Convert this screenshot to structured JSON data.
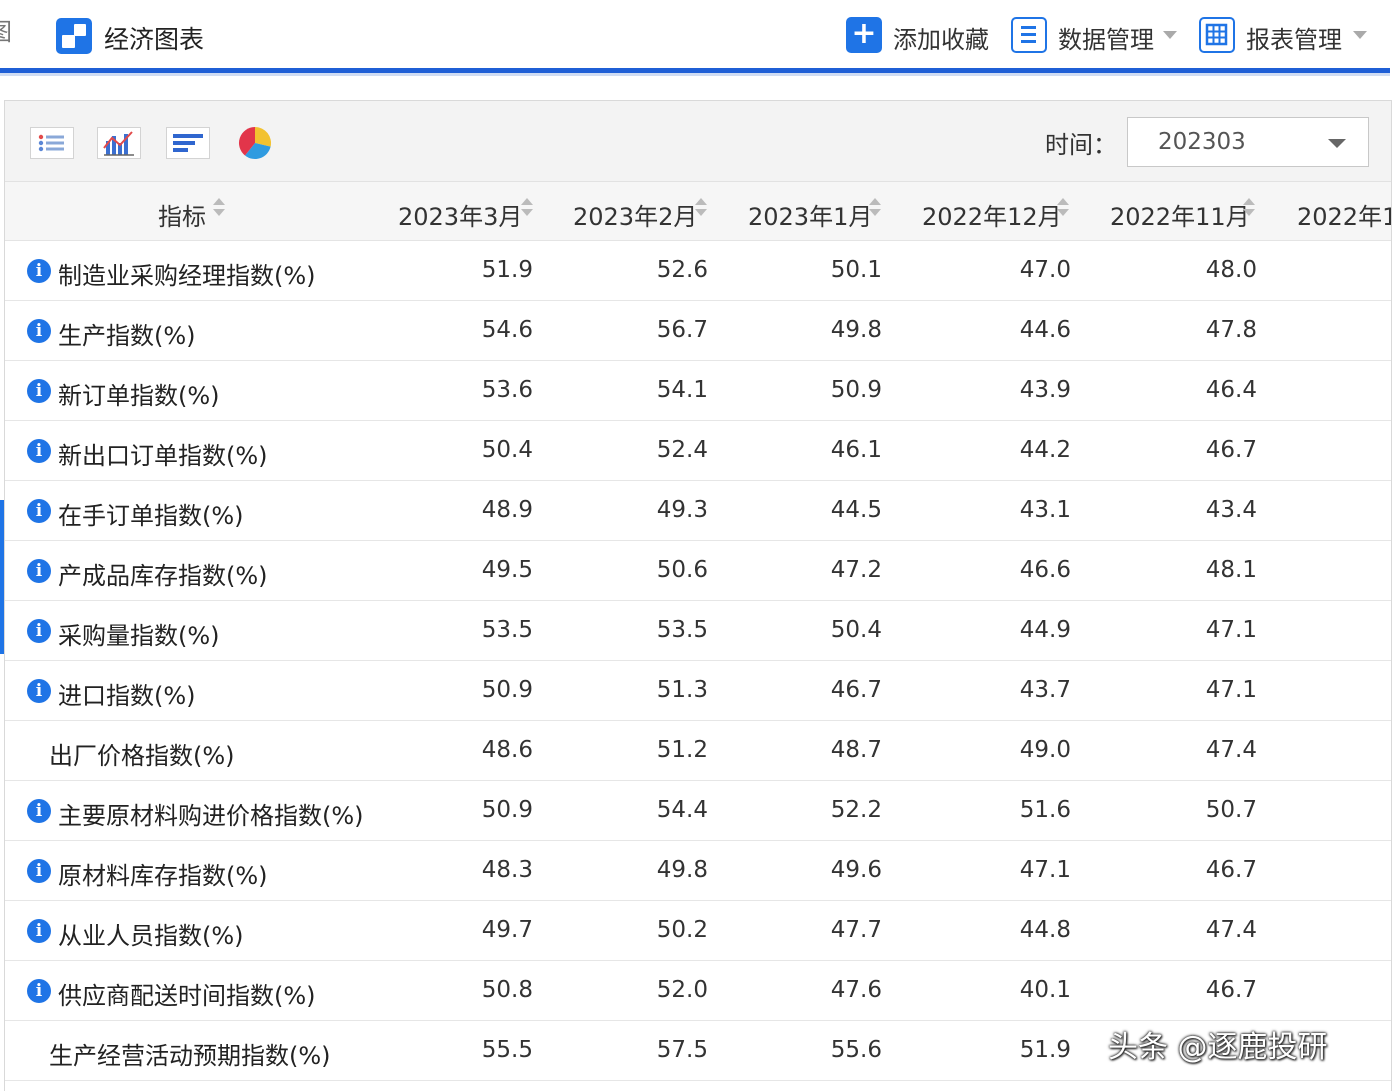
{
  "topbar": {
    "edge_glyph": "图",
    "app_title": "经济图表",
    "buttons": [
      {
        "label": "添加收藏",
        "icon": "plus-icon"
      },
      {
        "label": "数据管理",
        "icon": "list-box-icon"
      },
      {
        "label": "报表管理",
        "icon": "grid-table-icon"
      }
    ],
    "accent_color": "#1f74e6"
  },
  "toolbar": {
    "views": [
      "list-view-icon",
      "bar-chart-view-icon",
      "horizontal-bar-view-icon",
      "pie-chart-view-icon"
    ],
    "time_label": "时间：",
    "time_value": "202303"
  },
  "table": {
    "headers": [
      "指标",
      "2023年3月",
      "2023年2月",
      "2023年1月",
      "2022年12月",
      "2022年11月",
      "2022年1"
    ],
    "rows": [
      {
        "has_info": true,
        "name": "制造业采购经理指数(%)",
        "values": [
          "51.9",
          "52.6",
          "50.1",
          "47.0",
          "48.0"
        ]
      },
      {
        "has_info": true,
        "name": "生产指数(%)",
        "values": [
          "54.6",
          "56.7",
          "49.8",
          "44.6",
          "47.8"
        ]
      },
      {
        "has_info": true,
        "name": "新订单指数(%)",
        "values": [
          "53.6",
          "54.1",
          "50.9",
          "43.9",
          "46.4"
        ]
      },
      {
        "has_info": true,
        "name": "新出口订单指数(%)",
        "values": [
          "50.4",
          "52.4",
          "46.1",
          "44.2",
          "46.7"
        ]
      },
      {
        "has_info": true,
        "name": "在手订单指数(%)",
        "values": [
          "48.9",
          "49.3",
          "44.5",
          "43.1",
          "43.4"
        ]
      },
      {
        "has_info": true,
        "name": "产成品库存指数(%)",
        "values": [
          "49.5",
          "50.6",
          "47.2",
          "46.6",
          "48.1"
        ]
      },
      {
        "has_info": true,
        "name": "采购量指数(%)",
        "values": [
          "53.5",
          "53.5",
          "50.4",
          "44.9",
          "47.1"
        ]
      },
      {
        "has_info": true,
        "name": "进口指数(%)",
        "values": [
          "50.9",
          "51.3",
          "46.7",
          "43.7",
          "47.1"
        ]
      },
      {
        "has_info": false,
        "name": "出厂价格指数(%)",
        "values": [
          "48.6",
          "51.2",
          "48.7",
          "49.0",
          "47.4"
        ]
      },
      {
        "has_info": true,
        "name": "主要原材料购进价格指数(%)",
        "values": [
          "50.9",
          "54.4",
          "52.2",
          "51.6",
          "50.7"
        ]
      },
      {
        "has_info": true,
        "name": "原材料库存指数(%)",
        "values": [
          "48.3",
          "49.8",
          "49.6",
          "47.1",
          "46.7"
        ]
      },
      {
        "has_info": true,
        "name": "从业人员指数(%)",
        "values": [
          "49.7",
          "50.2",
          "47.7",
          "44.8",
          "47.4"
        ]
      },
      {
        "has_info": true,
        "name": "供应商配送时间指数(%)",
        "values": [
          "50.8",
          "52.0",
          "47.6",
          "40.1",
          "46.7"
        ]
      },
      {
        "has_info": false,
        "name": "生产经营活动预期指数(%)",
        "values": [
          "55.5",
          "57.5",
          "55.6",
          "51.9",
          ""
        ]
      }
    ]
  },
  "watermark": "头条 @逐鹿投研"
}
